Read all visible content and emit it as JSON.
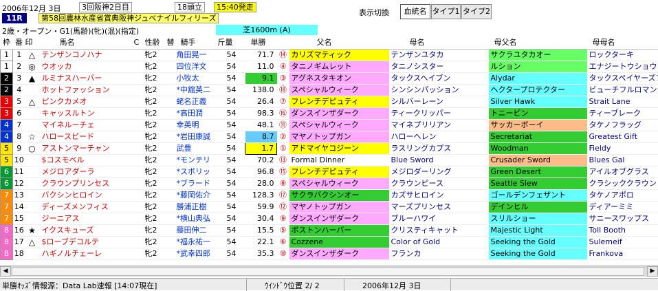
{
  "header": {
    "date": "2006年12月 3日",
    "meeting": "3回阪神2日目",
    "runners": "18頭立",
    "post_time": "15:40発走",
    "race_no": "11R",
    "race_name": "第58回農林水産省賞典阪神ジュベナイルフィリーズ",
    "conditions": "2歳・オープン・G1(馬齢)(牝)(混)(指定)",
    "course": "芝1600m (A)"
  },
  "toolbar": {
    "label": "表示切換",
    "tabs": [
      "血統名",
      "タイプ1",
      "タイプ2"
    ]
  },
  "columns": [
    "枠",
    "番",
    "印",
    "馬名",
    "C",
    "性齢",
    "替",
    "騎手",
    "斤量",
    "単勝",
    "父名",
    "母名",
    "母父名",
    "母母名"
  ],
  "frame_colors": {
    "1": "#ffffff",
    "2": "#000000",
    "3": "#e60000",
    "4": "#0033cc",
    "5": "#ffe600",
    "6": "#009933",
    "7": "#ff8c00",
    "8": "#ff66cc"
  },
  "horses": [
    {
      "waku": "1",
      "ban": "1",
      "mark": "△",
      "name": "テンザンコノハナ",
      "c": "",
      "sex": "牝2",
      "kae": "",
      "jockey": "角田晃一",
      "kin": "54",
      "odds": "71.7",
      "pop": "14",
      "sire": "カリズマティック",
      "dam": "テンザンユタカ",
      "bms": "サクラユタカオー",
      "dbms": "ロックターキ",
      "sire_bg": "#ffff00",
      "dam_bg": "#ffffff",
      "bms_bg": "#66ff66",
      "dbms_bg": "#ffffff",
      "odds_bg": ""
    },
    {
      "waku": "1",
      "ban": "2",
      "mark": "◎",
      "name": "ウオッカ",
      "c": "",
      "sex": "牝2",
      "kae": "",
      "jockey": "四位洋文",
      "kin": "54",
      "odds": "11.0",
      "pop": "4",
      "sire": "タニノギムレット",
      "dam": "タニノシスター",
      "bms": "ルション",
      "dbms": "エナジートウショウ",
      "sire_bg": "#ffaaff",
      "dam_bg": "#ffffff",
      "bms_bg": "#66ff66",
      "dbms_bg": "#ffffff",
      "odds_bg": ""
    },
    {
      "waku": "2",
      "ban": "3",
      "mark": "▲",
      "name": "ルミナスハーバー",
      "c": "",
      "sex": "牝2",
      "kae": "",
      "jockey": "小牧太",
      "kin": "54",
      "odds": "9.1",
      "pop": "3",
      "sire": "アグネスタキオン",
      "dam": "タックスヘイブン",
      "bms": "Alydar",
      "dbms": "タックスペイヤーズフィ",
      "sire_bg": "#ffaaff",
      "dam_bg": "#ffffff",
      "bms_bg": "#66ffff",
      "dbms_bg": "#ffffff",
      "odds_bg": "#33cc33"
    },
    {
      "waku": "2",
      "ban": "4",
      "mark": "",
      "name": "ホットファッション",
      "c": "",
      "sex": "牝2",
      "kae": "",
      "jockey": "*中舘英二",
      "kin": "54",
      "odds": "138.0",
      "pop": "18",
      "sire": "スペシャルウィーク",
      "dam": "シンシンパッション",
      "bms": "ヘクタープロテクター",
      "dbms": "ビューチフルロマン",
      "sire_bg": "#ffaaff",
      "dam_bg": "#ffffff",
      "bms_bg": "#66ffff",
      "dbms_bg": "#ffffff",
      "odds_bg": ""
    },
    {
      "waku": "3",
      "ban": "5",
      "mark": "△",
      "name": "ピンクカメオ",
      "c": "",
      "sex": "牝2",
      "kae": "",
      "jockey": "蛯名正義",
      "kin": "54",
      "odds": "26.4",
      "pop": "7",
      "sire": "フレンチデピュティ",
      "dam": "シルバーレーン",
      "bms": "Silver Hawk",
      "dbms": "Strait Lane",
      "sire_bg": "#ffff00",
      "dam_bg": "#ffffff",
      "bms_bg": "#66ffff",
      "dbms_bg": "#ffffff",
      "odds_bg": ""
    },
    {
      "waku": "3",
      "ban": "6",
      "mark": "",
      "name": "キャッスルトン",
      "c": "",
      "sex": "牝2",
      "kae": "",
      "jockey": "*高田潤",
      "kin": "54",
      "odds": "98.3",
      "pop": "16",
      "sire": "ダンスインザダーク",
      "dam": "ティークリッパー",
      "bms": "トニービン",
      "dbms": "ティーブレーク",
      "sire_bg": "#ffaaff",
      "dam_bg": "#ffffff",
      "bms_bg": "#33cc33",
      "dbms_bg": "#ffffff",
      "odds_bg": ""
    },
    {
      "waku": "4",
      "ban": "7",
      "mark": "",
      "name": "マイネルーチェ",
      "c": "",
      "sex": "牝2",
      "kae": "",
      "jockey": "幸英明",
      "kin": "54",
      "odds": "48.1",
      "pop": "11",
      "sire": "スペシャルウィーク",
      "dam": "マイネプリリアン",
      "bms": "サッカーボーイ",
      "dbms": "タケノフラッグ",
      "sire_bg": "#ffaaff",
      "dam_bg": "#ffffff",
      "bms_bg": "#ffbb88",
      "dbms_bg": "#ffffff",
      "odds_bg": ""
    },
    {
      "waku": "4",
      "ban": "8",
      "mark": "☆",
      "name": "ハロースピード",
      "c": "",
      "sex": "牝2",
      "kae": "",
      "jockey": "*岩田康誠",
      "kin": "54",
      "odds": "8.7",
      "pop": "2",
      "sire": "マヤノトップガン",
      "dam": "ハローヘレン",
      "bms": "Secretariat",
      "dbms": "Greatest Gift",
      "sire_bg": "#ffaaff",
      "dam_bg": "#ffffff",
      "bms_bg": "#33cc33",
      "dbms_bg": "#ffffff",
      "odds_bg": "#66ccff"
    },
    {
      "waku": "5",
      "ban": "9",
      "mark": "○",
      "name": "アストンマーチャン",
      "c": "",
      "sex": "牝2",
      "kae": "",
      "jockey": "武豊",
      "kin": "54",
      "odds": "1.7",
      "pop": "1",
      "sire": "アドマイヤコジーン",
      "dam": "ラスリングカプス",
      "bms": "Woodman",
      "dbms": "Fieldy",
      "sire_bg": "#ffff00",
      "dam_bg": "#ffffff",
      "bms_bg": "#33cc33",
      "dbms_bg": "#ffffff",
      "odds_bg": "#ffff00"
    },
    {
      "waku": "5",
      "ban": "10",
      "mark": "",
      "name": "$コスモベル",
      "c": "",
      "sex": "牝2",
      "kae": "",
      "jockey": "*モンテリ",
      "kin": "54",
      "odds": "70.2",
      "pop": "13",
      "sire": "Formal Dinner",
      "dam": "Blue Sword",
      "bms": "Crusader Sword",
      "dbms": "Blues Gal",
      "sire_bg": "#ffffff",
      "dam_bg": "#ffffff",
      "bms_bg": "#ffbb88",
      "dbms_bg": "#ffffff",
      "odds_bg": ""
    },
    {
      "waku": "6",
      "ban": "11",
      "mark": "",
      "name": "メジロアダーラ",
      "c": "",
      "sex": "牝2",
      "kae": "",
      "jockey": "*スボリッ",
      "kin": "54",
      "odds": "96.8",
      "pop": "15",
      "sire": "フレンチデピュティ",
      "dam": "メジロダーリング",
      "bms": "Green Desert",
      "dbms": "アイルオブグラス",
      "sire_bg": "#ffff00",
      "dam_bg": "#ffffff",
      "bms_bg": "#33cc33",
      "dbms_bg": "#ffffff",
      "odds_bg": ""
    },
    {
      "waku": "6",
      "ban": "12",
      "mark": "",
      "name": "クラウンプリンセス",
      "c": "",
      "sex": "牝2",
      "kae": "",
      "jockey": "*ブラード",
      "kin": "54",
      "odds": "28.0",
      "pop": "8",
      "sire": "スペシャルウィーク",
      "dam": "クラウンピース",
      "bms": "Seattle Slew",
      "dbms": "クラシッククラウン",
      "sire_bg": "#ffaaff",
      "dam_bg": "#ffffff",
      "bms_bg": "#33cc33",
      "dbms_bg": "#ffffff",
      "odds_bg": ""
    },
    {
      "waku": "7",
      "ban": "13",
      "mark": "",
      "name": "バクシンヒロイン",
      "c": "",
      "sex": "牝2",
      "kae": "",
      "jockey": "*藤岡佑介",
      "kin": "54",
      "odds": "128.3",
      "pop": "17",
      "sire": "サクラバクシンオー",
      "dam": "カズサヒロイン",
      "bms": "ゴールデンフェザント",
      "dbms": "タケノアポロ",
      "sire_bg": "#33cc33",
      "dam_bg": "#ffffff",
      "bms_bg": "#66ffff",
      "dbms_bg": "#ffffff",
      "odds_bg": ""
    },
    {
      "waku": "7",
      "ban": "14",
      "mark": "",
      "name": "ディーズメンフィス",
      "c": "",
      "sex": "牝2",
      "kae": "",
      "jockey": "勝浦正樹",
      "kin": "54",
      "odds": "59.9",
      "pop": "12",
      "sire": "マヤノトップガン",
      "dam": "マーズプリンセス",
      "bms": "デインヒル",
      "dbms": "ディアーミミ",
      "sire_bg": "#ffaaff",
      "dam_bg": "#ffffff",
      "bms_bg": "#33cc33",
      "dbms_bg": "#ffffff",
      "odds_bg": ""
    },
    {
      "waku": "7",
      "ban": "15",
      "mark": "",
      "name": "ジーニアス",
      "c": "",
      "sex": "牝2",
      "kae": "",
      "jockey": "*横山典弘",
      "kin": "54",
      "odds": "30.4",
      "pop": "9",
      "sire": "ダンスインザダーク",
      "dam": "ブルーハワイ",
      "bms": "スリルショー",
      "dbms": "サニースワップス",
      "sire_bg": "#ffaaff",
      "dam_bg": "#ffffff",
      "bms_bg": "#66ffff",
      "dbms_bg": "#ffffff",
      "odds_bg": ""
    },
    {
      "waku": "8",
      "ban": "16",
      "mark": "★",
      "name": "イクスキューズ",
      "c": "",
      "sex": "牝2",
      "kae": "",
      "jockey": "藤田伸二",
      "kin": "54",
      "odds": "15.5",
      "pop": "5",
      "sire": "ボストンハーバー",
      "dam": "クリスティキャット",
      "bms": "Majestic Light",
      "dbms": "Toll Booth",
      "sire_bg": "#33cc33",
      "dam_bg": "#ffffff",
      "bms_bg": "#66ffff",
      "dbms_bg": "#ffffff",
      "odds_bg": ""
    },
    {
      "waku": "8",
      "ban": "17",
      "mark": "△",
      "name": "$ローブデコルテ",
      "c": "",
      "sex": "牝2",
      "kae": "",
      "jockey": "*福永祐一",
      "kin": "54",
      "odds": "22.1",
      "pop": "6",
      "sire": "Cozzene",
      "dam": "Color of Gold",
      "bms": "Seeking the Gold",
      "dbms": "Sulemeif",
      "sire_bg": "#33cc33",
      "dam_bg": "#ffffff",
      "bms_bg": "#66ffff",
      "dbms_bg": "#ffffff",
      "odds_bg": ""
    },
    {
      "waku": "8",
      "ban": "18",
      "mark": "",
      "name": "ハギノルチェーレ",
      "c": "",
      "sex": "牝2",
      "kae": "",
      "jockey": "*武幸四郎",
      "kin": "54",
      "odds": "35.3",
      "pop": "10",
      "sire": "ダンスインザダーク",
      "dam": "フランカ",
      "bms": "Seeking the Gold",
      "dbms": "Frankova",
      "sire_bg": "#ffaaff",
      "dam_bg": "#ffffff",
      "bms_bg": "#66ffff",
      "dbms_bg": "#ffffff",
      "odds_bg": ""
    }
  ],
  "status": {
    "source": "単勝ｵｯｽﾞ情報源：Data Lab速報 [14:07現在]",
    "window_pos": "ｳｲﾝﾄﾞｳ位置 2/ 2",
    "date": "2006年12月 3日"
  }
}
